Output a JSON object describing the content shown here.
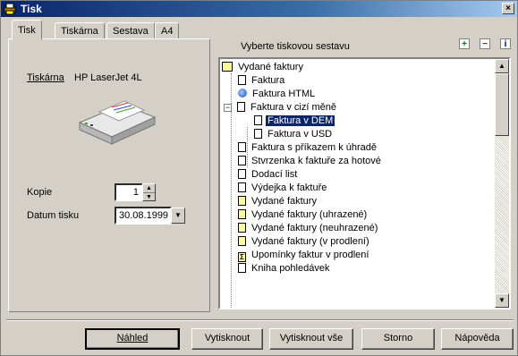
{
  "window": {
    "title": "Tisk",
    "close": "×"
  },
  "tabs": [
    {
      "label": "Tisk"
    },
    {
      "label": "Tiskárna"
    },
    {
      "label": "Sestava"
    },
    {
      "label": "A4"
    }
  ],
  "printer": {
    "label": "Tiskárna",
    "name": "HP LaserJet 4L"
  },
  "copies": {
    "label": "Kopie",
    "value": "1"
  },
  "print_date": {
    "label": "Datum tisku",
    "value": "30.08.1999"
  },
  "report_header": "Vyberte tiskovou sestavu",
  "header_buttons": {
    "add": "+",
    "remove": "−",
    "info": "i"
  },
  "tree": [
    {
      "label": "Vydané faktury",
      "icon": "book-icon"
    },
    {
      "label": "Faktura",
      "icon": "document-icon"
    },
    {
      "label": "Faktura HTML",
      "icon": "html-icon"
    },
    {
      "label": "Faktura v cizí měně",
      "icon": "document-icon"
    },
    {
      "label": "Faktura v DEM",
      "icon": "document-icon",
      "selected": true
    },
    {
      "label": "Faktura v USD",
      "icon": "document-icon"
    },
    {
      "label": "Faktura s příkazem k úhradě",
      "icon": "document-icon"
    },
    {
      "label": "Stvrzenka k faktuře za hotové",
      "icon": "document-icon"
    },
    {
      "label": "Dodací list",
      "icon": "document-icon"
    },
    {
      "label": "Výdejka k faktuře",
      "icon": "document-icon"
    },
    {
      "label": "Vydané faktury",
      "icon": "yellow-document-icon"
    },
    {
      "label": "Vydané faktury (uhrazené)",
      "icon": "yellow-document-icon"
    },
    {
      "label": "Vydané faktury (neuhrazené)",
      "icon": "yellow-document-icon"
    },
    {
      "label": "Vydané faktury (v prodlení)",
      "icon": "yellow-document-icon"
    },
    {
      "label": "Upomínky faktur v prodlení",
      "icon": "sigma-document-icon"
    },
    {
      "label": "Kniha pohledávek",
      "icon": "document-icon"
    }
  ],
  "buttons": {
    "preview": "Náhled",
    "print": "Vytisknout",
    "print_all": "Vytisknout vše",
    "cancel": "Storno",
    "help": "Nápověda"
  },
  "colors": {
    "selection": "#0a246a",
    "title_bar": "#0a246a",
    "dialog": "#d4d0c8"
  }
}
